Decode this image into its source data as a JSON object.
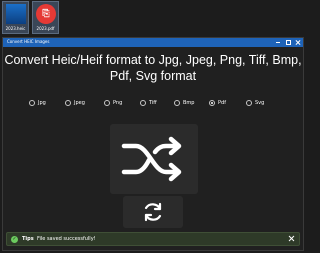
{
  "desktop": {
    "files": [
      {
        "name": "2023.heic",
        "icon": "image-file-icon"
      },
      {
        "name": "2023.pdf",
        "icon": "pdf-file-icon",
        "glyph": "⎘"
      }
    ]
  },
  "window": {
    "title": "Convert HEIC Images"
  },
  "heading": "Convert Heic/Heif format to Jpg, Jpeg, Png, Tiff, Bmp, Pdf, Svg format",
  "formats": {
    "options": [
      "Jpg",
      "Jpeg",
      "Png",
      "Tiff",
      "Bmp",
      "Pdf",
      "Svg"
    ],
    "selected": "Pdf"
  },
  "convert_button": {
    "icon": "shuffle-icon"
  },
  "reset_button": {
    "icon": "refresh-icon"
  },
  "toast": {
    "title": "Tips",
    "message": "File saved successfully!",
    "icon": "check-icon",
    "color": "#6ccb5f"
  },
  "colors": {
    "titlebar": "#1e63b8",
    "background": "#202020",
    "button": "#2b2b2b",
    "toast_bg": "#2e3a28"
  }
}
